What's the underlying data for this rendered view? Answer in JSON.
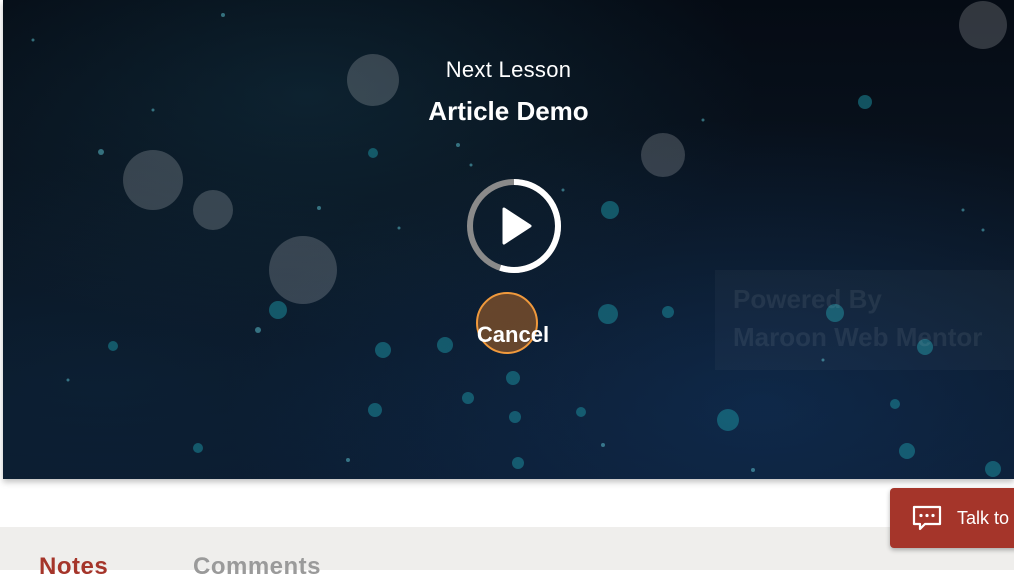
{
  "player": {
    "next_lesson_label": "Next Lesson",
    "lesson_title": "Article Demo",
    "cancel_label": "Cancel",
    "play_icon": "play-icon",
    "countdown_progress": 0.55,
    "watermark_lines": [
      "Powered By",
      "Maroon Web Mentor"
    ]
  },
  "tabs": {
    "items": [
      {
        "label": "Notes",
        "active": true
      },
      {
        "label": "Comments",
        "active": false
      }
    ]
  },
  "chat_widget": {
    "label": "Talk to",
    "icon": "chat-bubble-icon"
  },
  "colors": {
    "accent": "#a5352a",
    "cancel_ring": "#f0993c",
    "tab_inactive": "#9a9a9a",
    "tabs_background": "#efeeec"
  }
}
